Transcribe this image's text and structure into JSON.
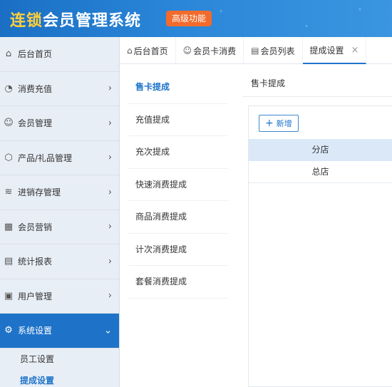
{
  "header": {
    "brand_highlight": "连锁",
    "brand_rest": "会员管理系统",
    "badge": "高级功能"
  },
  "sidebar": {
    "items": [
      {
        "label": "后台首页",
        "icon": "home-icon",
        "arrow": ""
      },
      {
        "label": "消费充值",
        "icon": "gauge-icon",
        "arrow": "›"
      },
      {
        "label": "会员管理",
        "icon": "user-icon",
        "arrow": "›"
      },
      {
        "label": "产品/礼品管理",
        "icon": "box-icon",
        "arrow": "›"
      },
      {
        "label": "进销存管理",
        "icon": "layers-icon",
        "arrow": "›"
      },
      {
        "label": "会员营销",
        "icon": "grid-icon",
        "arrow": "›"
      },
      {
        "label": "统计报表",
        "icon": "calendar-icon",
        "arrow": "›"
      },
      {
        "label": "用户管理",
        "icon": "user-doc-icon",
        "arrow": "›"
      },
      {
        "label": "系统设置",
        "icon": "gear-icon",
        "arrow": "⌄"
      }
    ],
    "subitems": [
      {
        "label": "员工设置"
      },
      {
        "label": "提成设置"
      }
    ]
  },
  "tabs": [
    {
      "label": "后台首页",
      "icon": "home-icon"
    },
    {
      "label": "会员卡消费",
      "icon": "user-icon"
    },
    {
      "label": "会员列表",
      "icon": "list-icon"
    },
    {
      "label": "提成设置",
      "icon": "",
      "close": "×"
    }
  ],
  "submenu": [
    "售卡提成",
    "充值提成",
    "充次提成",
    "快速消费提成",
    "商品消费提成",
    "计次消费提成",
    "套餐消费提成"
  ],
  "panel": {
    "title": "售卡提成",
    "add_label": "新增",
    "table": {
      "header": "分店",
      "rows": [
        "总店"
      ]
    }
  },
  "colors": {
    "accent": "#1e73c9",
    "badge": "#f26b2c",
    "brand_highlight": "#ffcf3a"
  }
}
